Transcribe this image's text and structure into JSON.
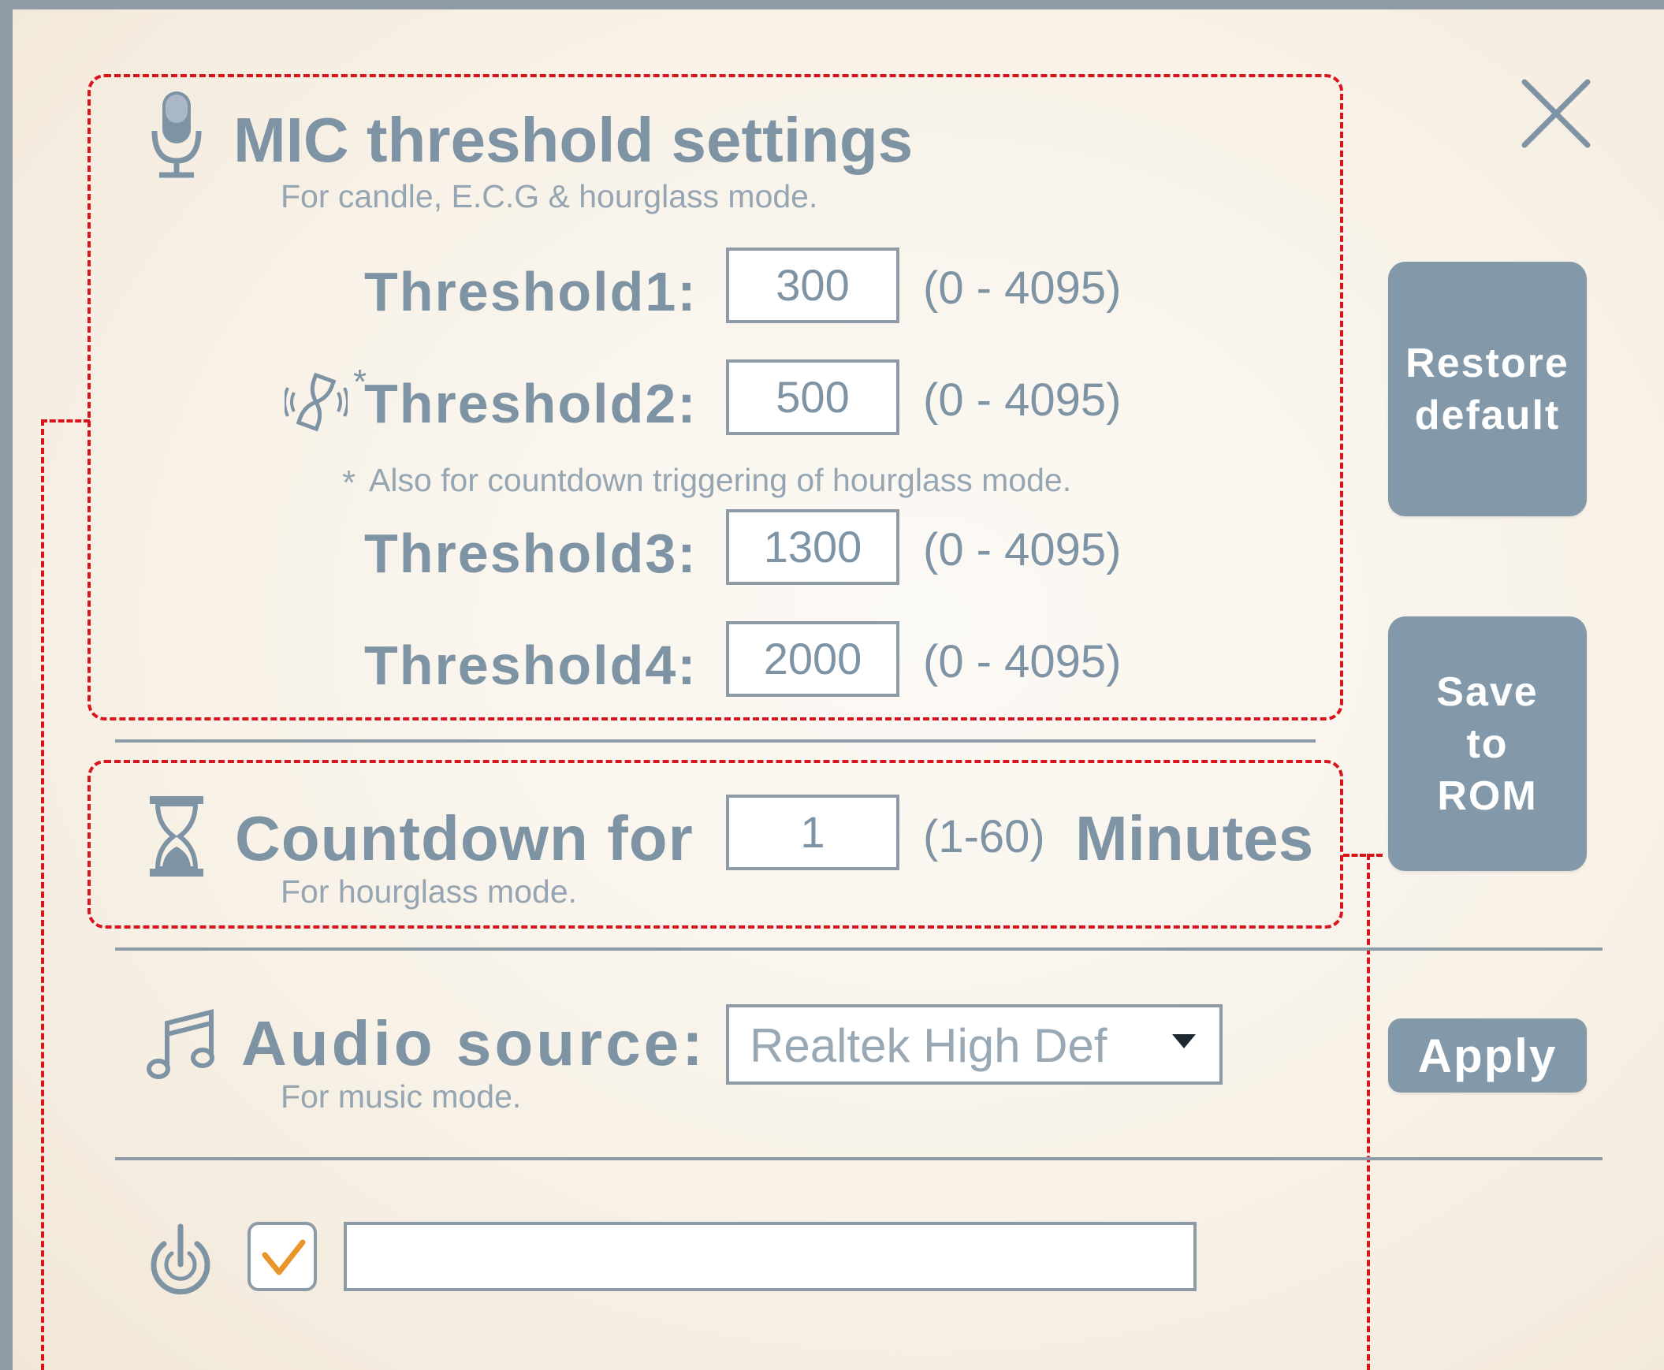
{
  "mic": {
    "title": "MIC threshold settings",
    "subtitle": "For candle, E.C.G & hourglass mode.",
    "thresholds": [
      {
        "label": "Threshold1:",
        "value": "300",
        "range": "(0 - 4095)"
      },
      {
        "label": "Threshold2:",
        "value": "500",
        "range": "(0 - 4095)"
      },
      {
        "label": "Threshold3:",
        "value": "1300",
        "range": "(0 - 4095)"
      },
      {
        "label": "Threshold4:",
        "value": "2000",
        "range": "(0 - 4095)"
      }
    ],
    "threshold2_marker": "*",
    "note_asterisk": "*",
    "note": "Also for countdown triggering of hourglass mode."
  },
  "countdown": {
    "title": "Countdown for",
    "value": "1",
    "range": "(1-60)",
    "unit": "Minutes",
    "subtitle": "For hourglass mode."
  },
  "audio": {
    "title": "Audio source:",
    "selected": "Realtek High Def",
    "subtitle": "For music mode."
  },
  "power": {
    "checked": true,
    "text_value": ""
  },
  "buttons": {
    "restore_line1": "Restore",
    "restore_line2": "default",
    "save_line1": "Save",
    "save_line2": "to",
    "save_line3": "ROM",
    "apply": "Apply"
  },
  "icons": {
    "close": "close-icon",
    "mic": "microphone-icon",
    "hourglass_sound": "hourglass-sound-icon",
    "hourglass": "hourglass-icon",
    "music": "music-note-icon",
    "power": "power-icon",
    "dropdown": "dropdown-arrow-icon",
    "check": "checkmark-icon"
  },
  "colors": {
    "accent": "#7e93a3",
    "button": "#8399a9",
    "annotation": "#d8141d",
    "check": "#e8962a"
  }
}
